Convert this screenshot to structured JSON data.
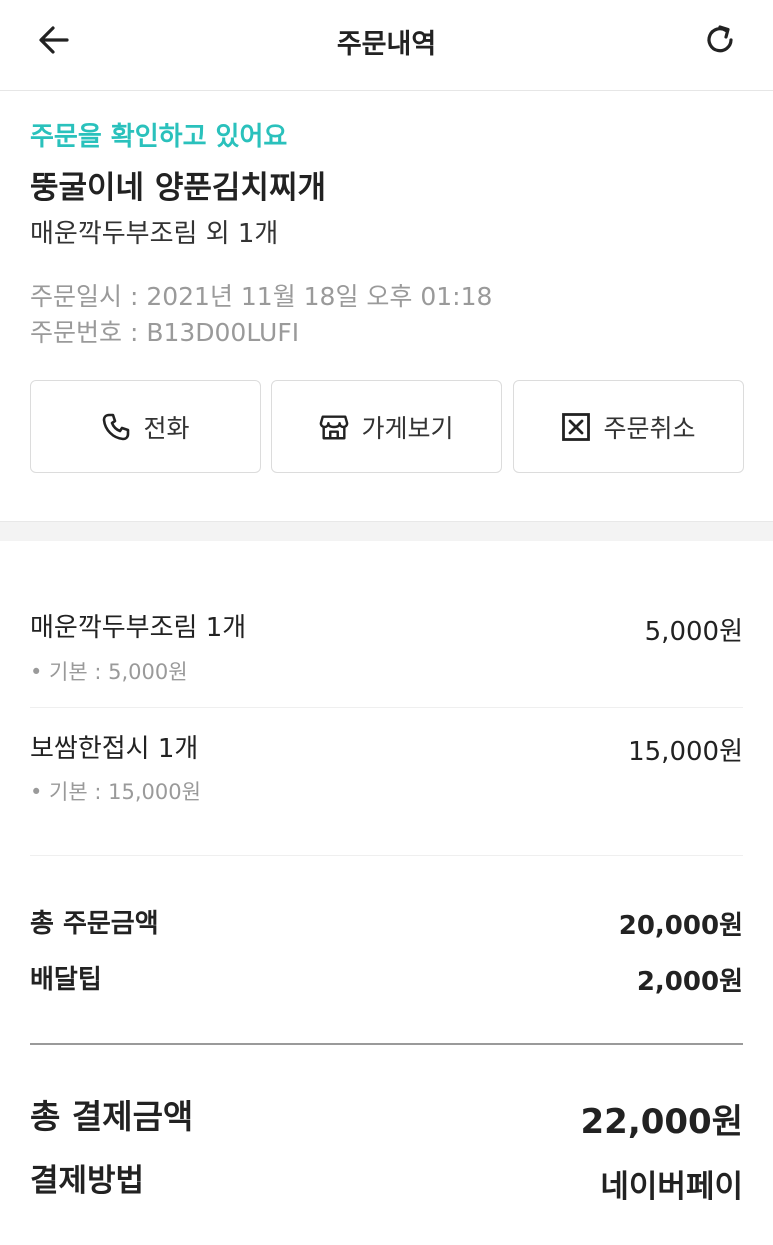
{
  "header": {
    "title": "주문내역",
    "back_icon": "arrow-left-icon",
    "refresh_icon": "refresh-icon"
  },
  "order": {
    "status": "주문을 확인하고 있어요",
    "store_name": "뚱굴이네 양푼김치찌개",
    "summary": "매운깍두부조림 외 1개",
    "date_text": "주문일시 : 2021년 11월 18일 오후 01:18",
    "number_text": "주문번호 : B13D00LUFI"
  },
  "actions": {
    "call_label": "전화",
    "store_label": "가게보기",
    "cancel_label": "주문취소"
  },
  "items": [
    {
      "name": "매운깍두부조림 1개",
      "price": "5,000원",
      "option": "• 기본 : 5,000원"
    },
    {
      "name": "보쌈한접시 1개",
      "price": "15,000원",
      "option": "• 기본 : 15,000원"
    }
  ],
  "summary": {
    "order_total_label": "총 주문금액",
    "order_total_value": "20,000원",
    "delivery_tip_label": "배달팁",
    "delivery_tip_value": "2,000원",
    "pay_total_label": "총 결제금액",
    "pay_total_value": "22,000원",
    "pay_method_label": "결제방법",
    "pay_method_value": "네이버페이"
  },
  "colors": {
    "accent": "#2ac1bc"
  }
}
